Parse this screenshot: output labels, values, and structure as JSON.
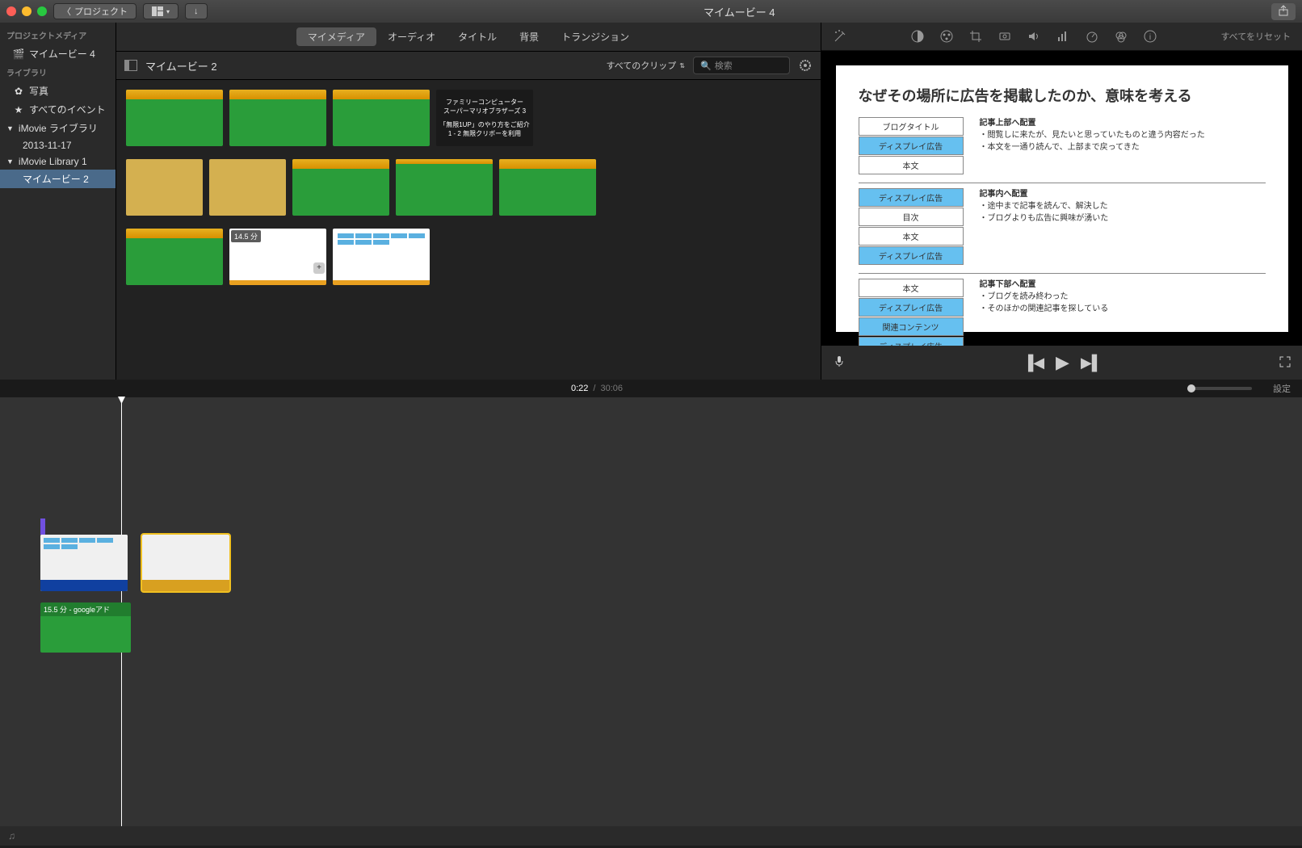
{
  "titlebar": {
    "back_label": "プロジェクト",
    "title": "マイムービー 4"
  },
  "sidebar": {
    "media_header": "プロジェクトメディア",
    "project": "マイムービー 4",
    "library_header": "ライブラリ",
    "photos": "写真",
    "all_events": "すべてのイベント",
    "imovie_lib": "iMovie ライブラリ",
    "date": "2013-11-17",
    "imovie_lib1": "iMovie Library 1",
    "movie2": "マイムービー 2"
  },
  "tabs": {
    "mymedia": "マイメディア",
    "audio": "オーディオ",
    "title": "タイトル",
    "bg": "背景",
    "transition": "トランジション"
  },
  "browser": {
    "project_name": "マイムービー 2",
    "filter": "すべてのクリップ",
    "search_placeholder": "検索",
    "clip_dark_line1": "ファミリーコンピューター",
    "clip_dark_line2": "スーパーマリオブラザーズ 3",
    "clip_dark_line3": "「無限1UP」のやり方をご紹介",
    "clip_dark_line4": "1 - 2 無限クリボーを利用",
    "clip_badge": "14.5 分"
  },
  "toolbar": {
    "reset": "すべてをリセット"
  },
  "preview": {
    "title": "なぜその場所に広告を掲載したのか、意味を考える",
    "section1_title": "記事上部へ配置",
    "section1_b1": "・閲覧しに来たが、見たいと思っていたものと違う内容だった",
    "section1_b2": "・本文を一通り読んで、上部まで戻ってきた",
    "box_blog_title": "ブログタイトル",
    "box_display_ad": "ディスプレイ広告",
    "box_body": "本文",
    "section2_title": "記事内へ配置",
    "section2_b1": "・途中まで記事を読んで、解決した",
    "section2_b2": "・ブログよりも広告に興味が湧いた",
    "box_toc": "目次",
    "section3_title": "記事下部へ配置",
    "section3_b1": "・ブログを読み終わった",
    "section3_b2": "・そのほかの関連記事を探している",
    "box_related": "関連コンテンツ"
  },
  "time": {
    "current": "0:22",
    "total": "30:06",
    "settings": "設定"
  },
  "timeline": {
    "audio_label": "15.5 分 - googleアド"
  }
}
